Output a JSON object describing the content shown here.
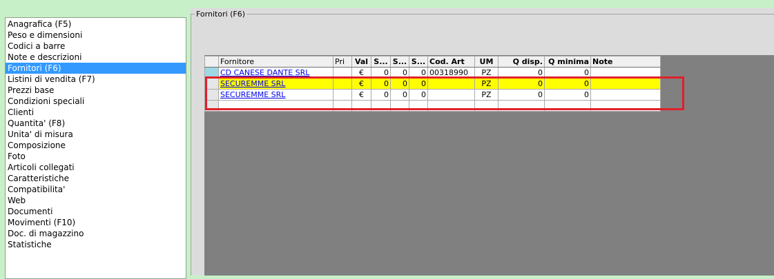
{
  "sidebar": {
    "items": [
      "Anagrafica (F5)",
      "Peso e dimensioni",
      "Codici a barre",
      "Note e descrizioni",
      "Fornitori (F6)",
      "Listini di vendita (F7)",
      "Prezzi base",
      "Condizioni speciali",
      "Clienti",
      "Quantita' (F8)",
      "Unita' di misura",
      "Composizione",
      "Foto",
      "Articoli collegati",
      "Caratteristiche",
      "Compatibilita'",
      "Web",
      "Documenti",
      "Movimenti (F10)",
      "Doc. di magazzino",
      "Statistiche"
    ],
    "selected": "Fornitori (F6)"
  },
  "panel": {
    "title": "Fornitori (F6)"
  },
  "grid": {
    "headers": [
      "Fornitore",
      "Pri",
      "Val",
      "S...",
      "S...",
      "S...",
      "Cod. Art",
      "UM",
      "Q disp.",
      "Q minima",
      "Note"
    ],
    "rows": [
      [
        "CD CANESE DANTE SRL",
        "",
        "€",
        "0",
        "0",
        "0",
        "00318990",
        "PZ",
        "0",
        "0",
        ""
      ],
      [
        "SECUREMME SRL",
        "",
        "€",
        "0",
        "0",
        "0",
        "",
        "PZ",
        "0",
        "0",
        ""
      ],
      [
        "SECUREMME SRL",
        "",
        "€",
        "0",
        "0",
        "0",
        "",
        "PZ",
        "0",
        "0",
        ""
      ],
      [
        "",
        "",
        "",
        "",
        "",
        "",
        "",
        "",
        "",
        "",
        ""
      ]
    ]
  },
  "colors": {
    "background": "#c8f0c8",
    "selection": "#3399ff",
    "highlight_row": "#ffff00",
    "annotation_box": "#e0202a"
  }
}
